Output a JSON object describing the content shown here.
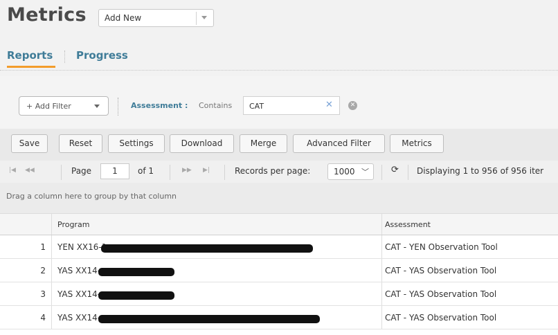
{
  "header": {
    "title": "Metrics",
    "add_new": {
      "label": "Add New"
    },
    "tabs": [
      {
        "label": "Reports",
        "active": true
      },
      {
        "label": "Progress",
        "active": false
      }
    ]
  },
  "filters": {
    "add_filter_label": "+ Add Filter",
    "active_filter": {
      "field": "Assessment :",
      "operator": "Contains",
      "value": "CAT"
    }
  },
  "toolbar": {
    "buttons": [
      "Save",
      "Reset",
      "Settings",
      "Download",
      "Merge",
      "Advanced Filter",
      "Metrics"
    ]
  },
  "pager": {
    "page_label": "Page",
    "page_value": "1",
    "of_label": "of 1",
    "records_label": "Records per page:",
    "records_value": "1000",
    "display_text": "Displaying 1 to 956 of 956 iter"
  },
  "group_hint": "Drag a column here to group by that column",
  "grid": {
    "columns": [
      "",
      "Program",
      "Assessment"
    ],
    "rows": [
      {
        "num": "1",
        "program": "YEN XX16-1",
        "assessment": "CAT - YEN Observation Tool"
      },
      {
        "num": "2",
        "program": "YAS XX14-",
        "assessment": "CAT - YAS Observation Tool"
      },
      {
        "num": "3",
        "program": "YAS XX14-",
        "assessment": "CAT - YAS Observation Tool"
      },
      {
        "num": "4",
        "program": "YAS XX14-",
        "assessment": "CAT - YAS Observation Tool"
      }
    ]
  },
  "colors": {
    "accent": "#3f7c98",
    "tab_underline": "#f39c2b"
  }
}
